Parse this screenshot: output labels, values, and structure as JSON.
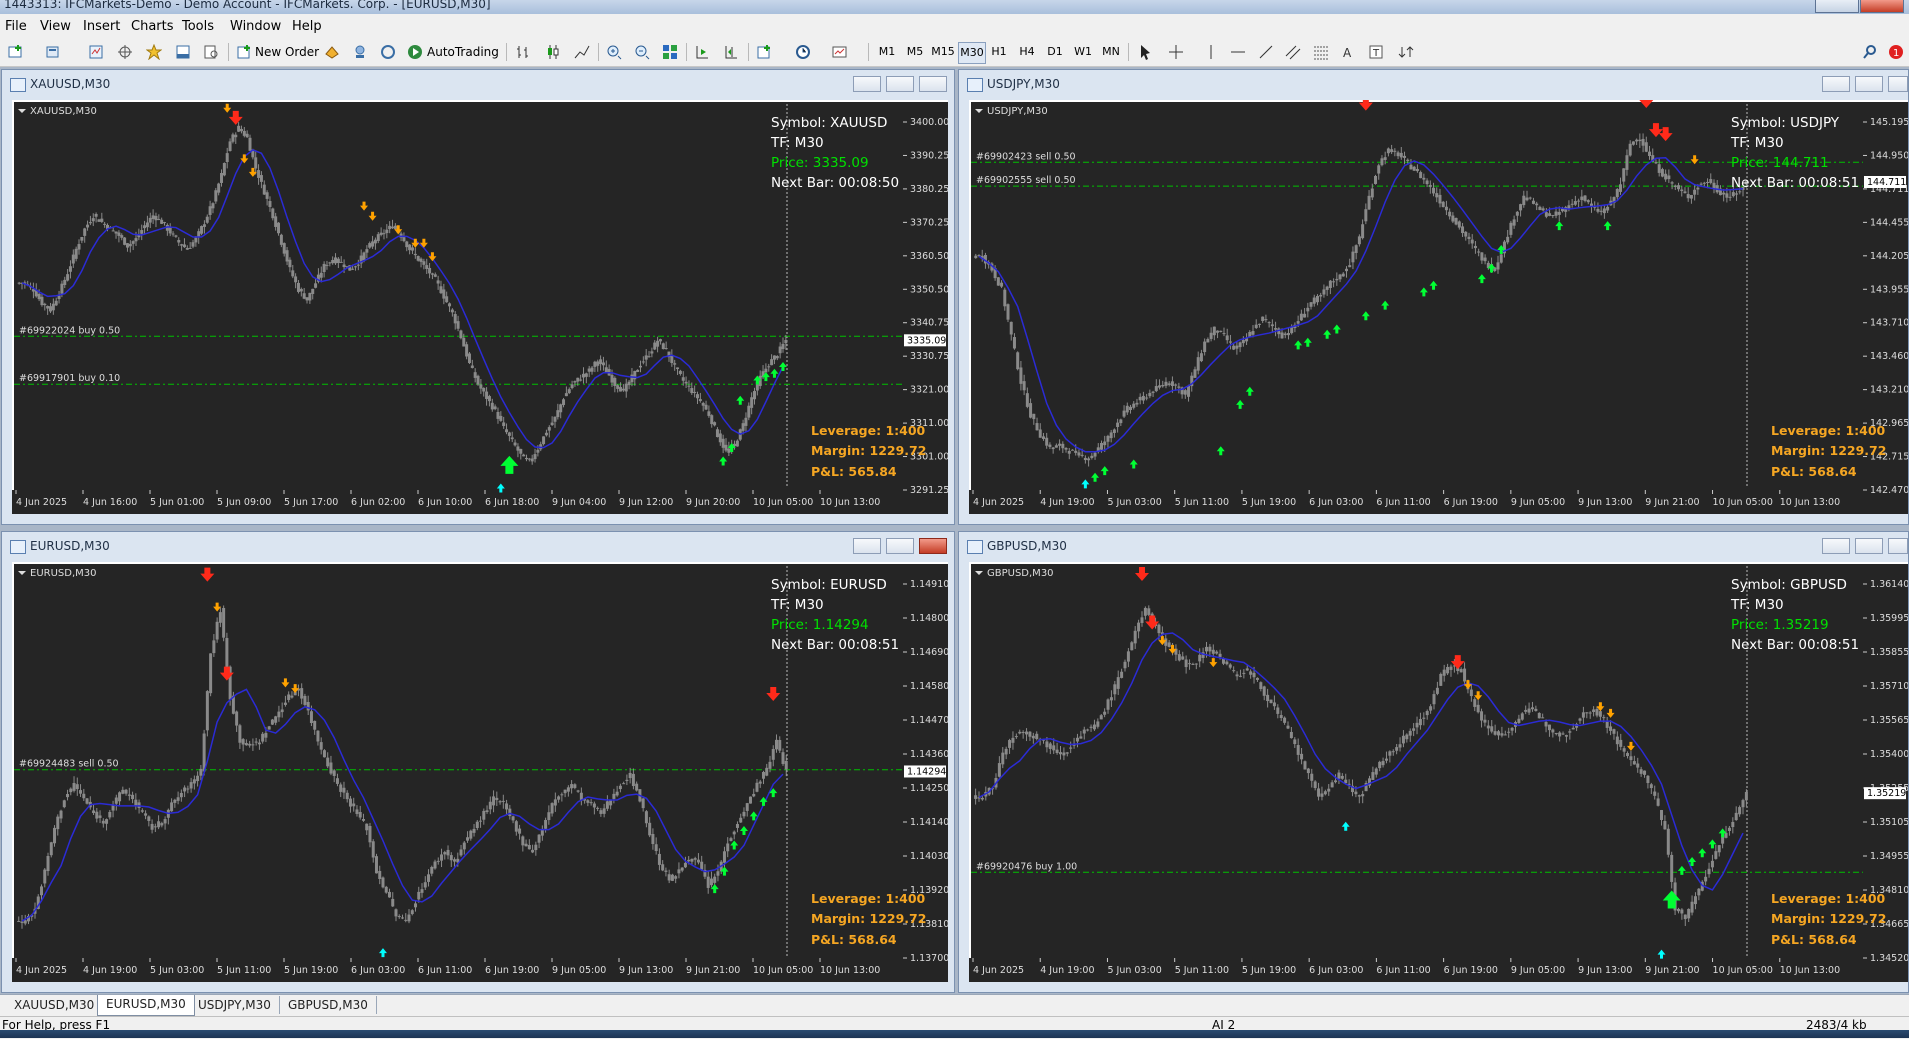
{
  "app": {
    "title": "1443313: IFCMarkets-Demo - Demo Account - IFCMarkets. Corp. - [EURUSD,M30]",
    "menu": [
      "File",
      "View",
      "Insert",
      "Charts",
      "Tools",
      "Window",
      "Help"
    ]
  },
  "toolbar": {
    "new_order": "New Order",
    "auto_trading": "AutoTrading",
    "timeframes": [
      "M1",
      "M5",
      "M15",
      "M30",
      "H1",
      "H4",
      "D1",
      "W1",
      "MN"
    ],
    "active_timeframe": "M30",
    "drawing_tools": [
      "cursor-icon",
      "crosshair-icon",
      "vertical-line-icon",
      "horizontal-line-icon",
      "trendline-icon",
      "channel-icon",
      "fibonacci-icon",
      "text-icon",
      "text-label-icon",
      "arrows-icon"
    ]
  },
  "colors": {
    "chart_bg": "#252525",
    "grid": "#3a3a3a",
    "candle": "#8a8a8a",
    "ma": "#2b2bd6",
    "level": "#00c000",
    "info_text": "#ffffff",
    "price_text": "#00e000",
    "trade_text": "#f5a623",
    "arrow_down_big": "#ff2a1a",
    "arrow_down_small": "#ffa200",
    "arrow_up_big": "#00ff33",
    "arrow_up_small": "#00ff33",
    "arrow_up_cyan": "#00ffff"
  },
  "charts": [
    {
      "title": "XAUUSD,M30",
      "label": "XAUUSD,M30",
      "info": [
        "Symbol: XAUUSD",
        "TF: M30",
        "Price: 3335.09",
        "Next Bar: 00:08:50"
      ],
      "trade": [
        "Leverage: 1:400",
        "Margin: 1229.72",
        "P&L: 565.84"
      ],
      "y_ticks": [
        "3400.00",
        "3390.25",
        "3380.25",
        "3370.25",
        "3360.50",
        "3350.50",
        "3340.75",
        "3330.75",
        "3321.00",
        "3311.00",
        "3301.00",
        "3291.25"
      ],
      "current_price_tag": "3335.09",
      "x_ticks": [
        "4 Jun 2025",
        "4 Jun 16:00",
        "5 Jun 01:00",
        "5 Jun 09:00",
        "5 Jun 17:00",
        "6 Jun 02:00",
        "6 Jun 10:00",
        "6 Jun 18:00",
        "9 Jun 04:00",
        "9 Jun 12:00",
        "9 Jun 20:00",
        "10 Jun 05:00",
        "10 Jun 13:00"
      ],
      "orders": [
        {
          "label": "#69922024 buy 0.50",
          "price": 3336.2
        },
        {
          "label": "#69917901 buy 0.10",
          "price": 3322.0
        }
      ],
      "ymin": 3291.25,
      "ymax": 3405.0,
      "closes": [
        3352,
        3350,
        3346,
        3344,
        3349,
        3355,
        3362,
        3368,
        3372,
        3370,
        3368,
        3366,
        3363,
        3365,
        3369,
        3372,
        3370,
        3367,
        3364,
        3362,
        3365,
        3370,
        3376,
        3384,
        3394,
        3398,
        3395,
        3386,
        3379,
        3372,
        3364,
        3356,
        3350,
        3347,
        3352,
        3357,
        3359,
        3358,
        3356,
        3358,
        3362,
        3365,
        3367,
        3369,
        3366,
        3362,
        3359,
        3356,
        3353,
        3348,
        3343,
        3336,
        3328,
        3322,
        3318,
        3314,
        3309,
        3305,
        3301,
        3299,
        3303,
        3308,
        3312,
        3318,
        3322,
        3324,
        3326,
        3329,
        3326,
        3322,
        3320,
        3324,
        3328,
        3331,
        3335,
        3332,
        3327,
        3323,
        3320,
        3317,
        3313,
        3307,
        3302,
        3304,
        3310,
        3318,
        3324,
        3328,
        3331,
        3335
      ],
      "arrows": [
        {
          "i": 24,
          "type": "down_small",
          "price": 3403
        },
        {
          "i": 25,
          "type": "down_big",
          "price": 3400
        },
        {
          "i": 26,
          "type": "down_small",
          "price": 3388
        },
        {
          "i": 27,
          "type": "down_small",
          "price": 3384
        },
        {
          "i": 40,
          "type": "down_small",
          "price": 3374
        },
        {
          "i": 41,
          "type": "down_small",
          "price": 3371
        },
        {
          "i": 44,
          "type": "down_small",
          "price": 3367
        },
        {
          "i": 46,
          "type": "down_small",
          "price": 3363
        },
        {
          "i": 47,
          "type": "down_small",
          "price": 3363
        },
        {
          "i": 48,
          "type": "down_small",
          "price": 3359
        },
        {
          "i": 57,
          "type": "up_big",
          "price": 3299
        },
        {
          "i": 56,
          "type": "up_cyan",
          "price": 3292
        },
        {
          "i": 82,
          "type": "up_small",
          "price": 3300
        },
        {
          "i": 83,
          "type": "up_small",
          "price": 3304
        },
        {
          "i": 84,
          "type": "up_small",
          "price": 3318
        },
        {
          "i": 86,
          "type": "up_small",
          "price": 3324
        },
        {
          "i": 87,
          "type": "up_small",
          "price": 3325
        },
        {
          "i": 88,
          "type": "up_small",
          "price": 3326
        },
        {
          "i": 89,
          "type": "up_small",
          "price": 3328
        }
      ]
    },
    {
      "title": "USDJPY,M30",
      "label": "USDJPY,M30",
      "info": [
        "Symbol: USDJPY",
        "TF: M30",
        "Price: 144.711",
        "Next Bar: 00:08:51"
      ],
      "trade": [
        "Leverage: 1:400",
        "Margin: 1229.72",
        "P&L: 568.64"
      ],
      "y_ticks": [
        "145.195",
        "144.950",
        "144.711",
        "144.455",
        "144.205",
        "143.955",
        "143.710",
        "143.460",
        "143.210",
        "142.965",
        "142.715",
        "142.470"
      ],
      "current_price_tag": "144.711",
      "x_ticks": [
        "4 Jun 2025",
        "4 Jun 19:00",
        "5 Jun 03:00",
        "5 Jun 11:00",
        "5 Jun 19:00",
        "6 Jun 03:00",
        "6 Jun 11:00",
        "6 Jun 19:00",
        "9 Jun 05:00",
        "9 Jun 13:00",
        "9 Jun 21:00",
        "10 Jun 05:00",
        "10 Jun 13:00"
      ],
      "orders": [
        {
          "label": "#69902423 sell 0.50",
          "price": 144.86
        },
        {
          "label": "#69902555 sell 0.50",
          "price": 144.68
        }
      ],
      "ymin": 142.4,
      "ymax": 145.3,
      "closes": [
        144.15,
        144.05,
        143.9,
        143.55,
        143.2,
        142.95,
        142.8,
        142.7,
        142.72,
        142.68,
        142.65,
        142.62,
        142.7,
        142.78,
        142.9,
        143.0,
        143.05,
        143.1,
        143.15,
        143.2,
        143.18,
        143.1,
        143.3,
        143.5,
        143.6,
        143.55,
        143.45,
        143.5,
        143.6,
        143.68,
        143.62,
        143.55,
        143.6,
        143.7,
        143.8,
        143.85,
        143.95,
        144.0,
        144.1,
        144.3,
        144.6,
        144.85,
        144.95,
        144.92,
        144.85,
        144.78,
        144.7,
        144.6,
        144.5,
        144.4,
        144.3,
        144.2,
        144.1,
        144.05,
        144.25,
        144.45,
        144.6,
        144.55,
        144.48,
        144.45,
        144.5,
        144.55,
        144.6,
        144.52,
        144.48,
        144.55,
        144.7,
        145.0,
        145.05,
        144.9,
        144.8,
        144.72,
        144.65,
        144.6,
        144.68,
        144.72,
        144.65,
        144.6,
        144.62,
        144.711
      ],
      "arrows": [
        {
          "i": 40,
          "type": "down_big",
          "price": 145.28
        },
        {
          "i": 69,
          "type": "down_big",
          "price": 145.3
        },
        {
          "i": 70,
          "type": "down_big",
          "price": 145.08
        },
        {
          "i": 71,
          "type": "down_big",
          "price": 145.05
        },
        {
          "i": 74,
          "type": "down_small",
          "price": 144.86
        },
        {
          "i": 11,
          "type": "up_cyan",
          "price": 142.45
        },
        {
          "i": 12,
          "type": "up_small",
          "price": 142.5
        },
        {
          "i": 13,
          "type": "up_small",
          "price": 142.55
        },
        {
          "i": 16,
          "type": "up_small",
          "price": 142.6
        },
        {
          "i": 25,
          "type": "up_small",
          "price": 142.7
        },
        {
          "i": 27,
          "type": "up_small",
          "price": 143.05
        },
        {
          "i": 28,
          "type": "up_small",
          "price": 143.15
        },
        {
          "i": 33,
          "type": "up_small",
          "price": 143.5
        },
        {
          "i": 34,
          "type": "up_small",
          "price": 143.52
        },
        {
          "i": 36,
          "type": "up_small",
          "price": 143.58
        },
        {
          "i": 37,
          "type": "up_small",
          "price": 143.62
        },
        {
          "i": 40,
          "type": "up_small",
          "price": 143.72
        },
        {
          "i": 42,
          "type": "up_small",
          "price": 143.8
        },
        {
          "i": 46,
          "type": "up_small",
          "price": 143.9
        },
        {
          "i": 47,
          "type": "up_small",
          "price": 143.95
        },
        {
          "i": 52,
          "type": "up_small",
          "price": 144.0
        },
        {
          "i": 53,
          "type": "up_small",
          "price": 144.08
        },
        {
          "i": 54,
          "type": "up_small",
          "price": 144.22
        },
        {
          "i": 60,
          "type": "up_small",
          "price": 144.4
        },
        {
          "i": 65,
          "type": "up_small",
          "price": 144.4
        }
      ]
    },
    {
      "title": "EURUSD,M30",
      "label": "EURUSD,M30",
      "info": [
        "Symbol: EURUSD",
        "TF: M30",
        "Price: 1.14294",
        "Next Bar: 00:08:51"
      ],
      "trade": [
        "Leverage: 1:400",
        "Margin: 1229.72",
        "P&L: 568.64"
      ],
      "y_ticks": [
        "1.14910",
        "1.14800",
        "1.14690",
        "1.14580",
        "1.14470",
        "1.14360",
        "1.14250",
        "1.14140",
        "1.14030",
        "1.13920",
        "1.13810",
        "1.13700"
      ],
      "current_price_tag": "1.14294",
      "x_ticks": [
        "4 Jun 2025",
        "4 Jun 19:00",
        "5 Jun 03:00",
        "5 Jun 11:00",
        "5 Jun 19:00",
        "6 Jun 03:00",
        "6 Jun 11:00",
        "6 Jun 19:00",
        "9 Jun 05:00",
        "9 Jun 13:00",
        "9 Jun 21:00",
        "10 Jun 05:00",
        "10 Jun 13:00"
      ],
      "orders": [
        {
          "label": "#69924483 sell 0.50",
          "price": 1.143
        }
      ],
      "ymin": 1.1366,
      "ymax": 1.15,
      "closes": [
        1.1378,
        1.1382,
        1.1395,
        1.141,
        1.142,
        1.1425,
        1.142,
        1.1415,
        1.1412,
        1.1418,
        1.1423,
        1.142,
        1.1415,
        1.141,
        1.1412,
        1.1418,
        1.1422,
        1.1425,
        1.143,
        1.147,
        1.1485,
        1.1455,
        1.144,
        1.1438,
        1.144,
        1.1445,
        1.145,
        1.1455,
        1.1458,
        1.145,
        1.144,
        1.1432,
        1.1425,
        1.142,
        1.1415,
        1.141,
        1.1395,
        1.1388,
        1.138,
        1.1378,
        1.1385,
        1.1392,
        1.1398,
        1.1402,
        1.1398,
        1.1405,
        1.141,
        1.1415,
        1.142,
        1.1418,
        1.1412,
        1.1405,
        1.1402,
        1.141,
        1.1418,
        1.1422,
        1.1425,
        1.142,
        1.1418,
        1.1415,
        1.142,
        1.1425,
        1.1428,
        1.142,
        1.1408,
        1.1398,
        1.1392,
        1.1395,
        1.14,
        1.1398,
        1.139,
        1.1395,
        1.1405,
        1.1412,
        1.1418,
        1.1425,
        1.143,
        1.144,
        1.14294
      ],
      "arrows": [
        {
          "i": 19,
          "type": "down_big",
          "price": 1.1496
        },
        {
          "i": 20,
          "type": "down_small",
          "price": 1.1485
        },
        {
          "i": 21,
          "type": "down_big",
          "price": 1.1462
        },
        {
          "i": 27,
          "type": "down_small",
          "price": 1.1459
        },
        {
          "i": 28,
          "type": "down_small",
          "price": 1.1457
        },
        {
          "i": 77,
          "type": "down_big",
          "price": 1.1455
        },
        {
          "i": 37,
          "type": "up_cyan",
          "price": 1.1368
        },
        {
          "i": 71,
          "type": "up_small",
          "price": 1.139
        },
        {
          "i": 72,
          "type": "up_small",
          "price": 1.1396
        },
        {
          "i": 73,
          "type": "up_small",
          "price": 1.1405
        },
        {
          "i": 74,
          "type": "up_small",
          "price": 1.141
        },
        {
          "i": 75,
          "type": "up_small",
          "price": 1.1415
        },
        {
          "i": 76,
          "type": "up_small",
          "price": 1.142
        },
        {
          "i": 77,
          "type": "up_small",
          "price": 1.1423
        }
      ]
    },
    {
      "title": "GBPUSD,M30",
      "label": "GBPUSD,M30",
      "info": [
        "Symbol: GBPUSD",
        "TF: M30",
        "Price: 1.35219",
        "Next Bar: 00:08:51"
      ],
      "trade": [
        "Leverage: 1:400",
        "Margin: 1229.72",
        "P&L: 568.64"
      ],
      "y_ticks": [
        "1.36140",
        "1.35995",
        "1.35855",
        "1.35710",
        "1.35565",
        "1.35400",
        "1.35255",
        "1.35105",
        "1.34955",
        "1.34810",
        "1.34665",
        "1.34520"
      ],
      "current_price_tag": "1.35219",
      "x_ticks": [
        "4 Jun 2025",
        "4 Jun 19:00",
        "5 Jun 03:00",
        "5 Jun 11:00",
        "5 Jun 19:00",
        "6 Jun 03:00",
        "6 Jun 11:00",
        "6 Jun 19:00",
        "9 Jun 05:00",
        "9 Jun 13:00",
        "9 Jun 21:00",
        "10 Jun 05:00",
        "10 Jun 13:00"
      ],
      "orders": [
        {
          "label": "#69920476 buy 1.00",
          "price": 1.3486
        }
      ],
      "ymin": 1.3448,
      "ymax": 1.3625,
      "closes": [
        1.352,
        1.3525,
        1.354,
        1.3548,
        1.355,
        1.3548,
        1.3545,
        1.3542,
        1.354,
        1.3545,
        1.355,
        1.3552,
        1.356,
        1.357,
        1.3582,
        1.3595,
        1.3605,
        1.3598,
        1.359,
        1.3585,
        1.358,
        1.3582,
        1.3588,
        1.3585,
        1.358,
        1.3575,
        1.3578,
        1.3572,
        1.3565,
        1.3558,
        1.355,
        1.354,
        1.353,
        1.352,
        1.3525,
        1.353,
        1.3525,
        1.352,
        1.3528,
        1.3535,
        1.354,
        1.3545,
        1.355,
        1.3555,
        1.3562,
        1.3575,
        1.358,
        1.3578,
        1.3565,
        1.3555,
        1.355,
        1.3548,
        1.3552,
        1.3558,
        1.356,
        1.3555,
        1.355,
        1.3548,
        1.3552,
        1.3558,
        1.356,
        1.3555,
        1.3548,
        1.354,
        1.3535,
        1.353,
        1.352,
        1.3505,
        1.347,
        1.3465,
        1.3475,
        1.3485,
        1.3495,
        1.3505,
        1.3512,
        1.35219
      ],
      "arrows": [
        {
          "i": 16,
          "type": "down_big",
          "price": 1.362
        },
        {
          "i": 17,
          "type": "down_big",
          "price": 1.3598
        },
        {
          "i": 18,
          "type": "down_small",
          "price": 1.359
        },
        {
          "i": 19,
          "type": "down_small",
          "price": 1.3586
        },
        {
          "i": 23,
          "type": "down_small",
          "price": 1.358
        },
        {
          "i": 47,
          "type": "down_big",
          "price": 1.358
        },
        {
          "i": 48,
          "type": "down_small",
          "price": 1.357
        },
        {
          "i": 49,
          "type": "down_small",
          "price": 1.3565
        },
        {
          "i": 61,
          "type": "down_small",
          "price": 1.356
        },
        {
          "i": 62,
          "type": "down_small",
          "price": 1.3557
        },
        {
          "i": 64,
          "type": "down_small",
          "price": 1.3542
        },
        {
          "i": 36,
          "type": "up_cyan",
          "price": 1.3508
        },
        {
          "i": 67,
          "type": "up_cyan",
          "price": 1.345
        },
        {
          "i": 68,
          "type": "up_big",
          "price": 1.3475
        },
        {
          "i": 69,
          "type": "up_small",
          "price": 1.3488
        },
        {
          "i": 70,
          "type": "up_small",
          "price": 1.3492
        },
        {
          "i": 71,
          "type": "up_small",
          "price": 1.3496
        },
        {
          "i": 72,
          "type": "up_small",
          "price": 1.35
        },
        {
          "i": 73,
          "type": "up_small",
          "price": 1.3505
        }
      ]
    }
  ],
  "tabs": [
    "XAUUSD,M30",
    "EURUSD,M30",
    "USDJPY,M30",
    "GBPUSD,M30"
  ],
  "active_tab": "EURUSD,M30",
  "status": {
    "help": "For Help, press F1",
    "profile": "AI 2",
    "traffic": "2483/4 kb"
  }
}
